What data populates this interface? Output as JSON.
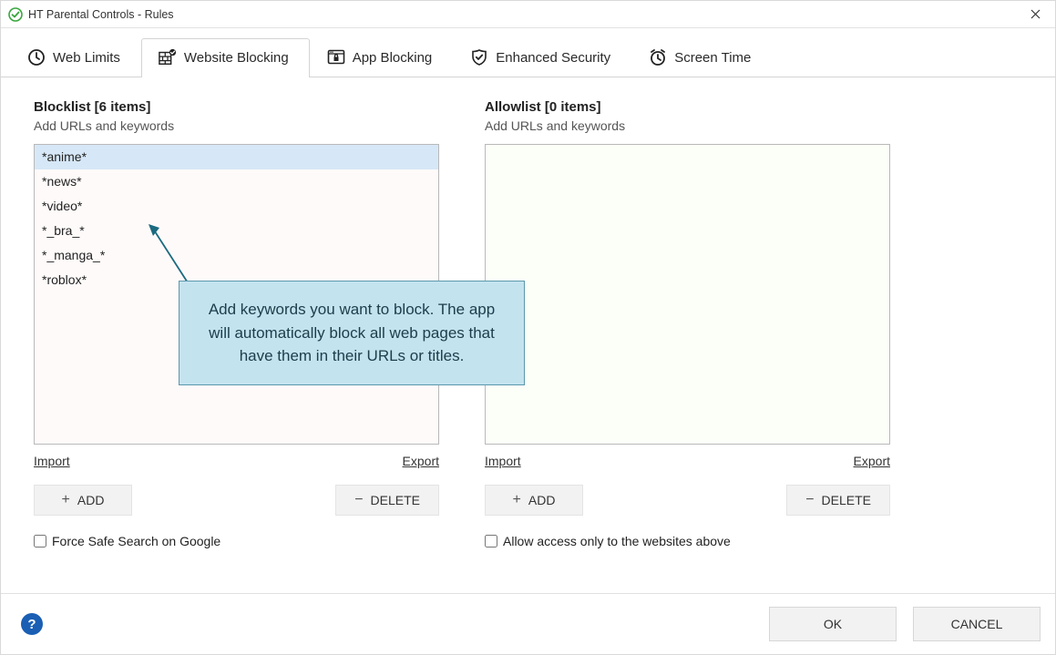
{
  "window": {
    "title": "HT Parental Controls - Rules"
  },
  "tabs": {
    "web_limits": "Web Limits",
    "website_blocking": "Website Blocking",
    "app_blocking": "App Blocking",
    "enhanced_security": "Enhanced Security",
    "screen_time": "Screen Time"
  },
  "blocklist": {
    "title": "Blocklist [6 items]",
    "sub": "Add URLs and keywords",
    "items": [
      "*anime*",
      "*news*",
      "*video*",
      "*_bra_*",
      "*_manga_*",
      "*roblox*"
    ],
    "import": "Import",
    "export": "Export",
    "add": "ADD",
    "delete": "DELETE",
    "checkbox": "Force Safe Search on Google"
  },
  "allowlist": {
    "title": "Allowlist [0 items]",
    "sub": "Add URLs and keywords",
    "items": [],
    "import": "Import",
    "export": "Export",
    "add": "ADD",
    "delete": "DELETE",
    "checkbox": "Allow access only to the websites above"
  },
  "tooltip": "Add keywords you want to block. The app will automatically block all web pages that have them in their URLs or titles.",
  "footer": {
    "ok": "OK",
    "cancel": "CANCEL"
  }
}
